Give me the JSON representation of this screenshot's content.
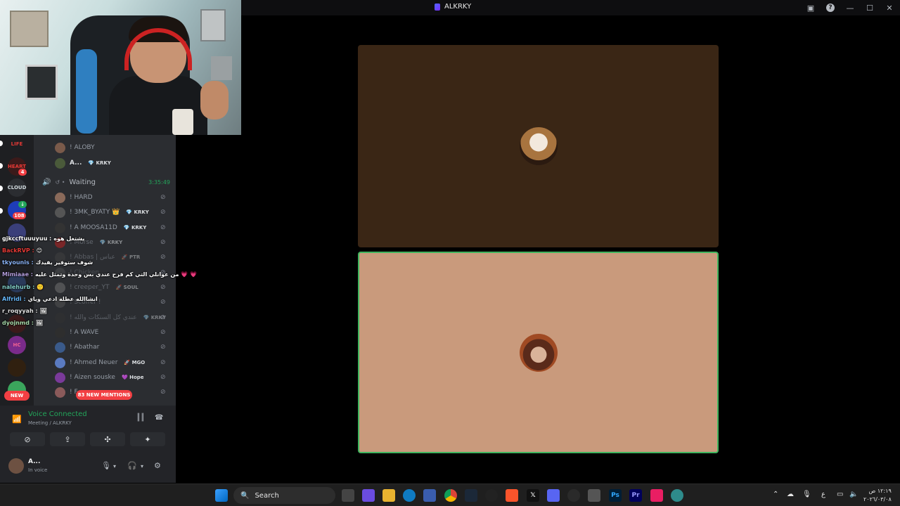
{
  "window": {
    "title": "ALKRKY"
  },
  "servers": [
    {
      "label": "LIFE",
      "color": "#2b2d31"
    },
    {
      "label": "HEART",
      "color": "#3b1a1a",
      "badge": "4"
    },
    {
      "label": "CLOUD",
      "color": "#1e1f22"
    },
    {
      "label": "",
      "color": "#1e3db8",
      "badge": "108"
    },
    {
      "label": "",
      "color": "#3a3f7a"
    },
    {
      "label": "",
      "color": "#222"
    },
    {
      "label": "",
      "color": "#7a2b8a"
    },
    {
      "label": "",
      "color": "#302010"
    },
    {
      "label": "",
      "color": "#3ba55c"
    }
  ],
  "new_button": "NEW",
  "channel_users_top": [
    {
      "name": "! ALOBY",
      "tag": ""
    },
    {
      "name": "A...",
      "tag": "💎 KRKY"
    }
  ],
  "voice_channel": {
    "name": "Waiting",
    "time": "3:35:49"
  },
  "channel_users": [
    {
      "name": "! HARD",
      "tag": ""
    },
    {
      "name": "! 3MK_BYATY 👑",
      "tag": "💎 KRKY"
    },
    {
      "name": "! A MOOSA11D",
      "tag": "💎 KRKY"
    },
    {
      "name": "! Morse",
      "tag": "💎 KRKY"
    },
    {
      "name": "! Abbas | عباس",
      "tag": "🚀 PTR"
    },
    {
      "name": "! Chicken",
      "tag": ""
    },
    {
      "name": "! creeper_YT",
      "tag": "🚀 SOUL"
    },
    {
      "name": "! Scoffer !",
      "tag": ""
    },
    {
      "name": "! عندي كل السنكات والله",
      "tag": "💎 KRKY"
    },
    {
      "name": "! A WAVE",
      "tag": ""
    },
    {
      "name": "! Abathar",
      "tag": ""
    },
    {
      "name": "! Ahmed Neuer",
      "tag": "🚀 MGO"
    },
    {
      "name": "! Aizen souske",
      "tag": "💜 Hope"
    },
    {
      "name": "! F",
      "tag": ""
    }
  ],
  "mentions_label": "83 NEW MENTIONS",
  "chat": [
    {
      "user": "gjkccftuuuyuu :",
      "msg": "يشتغل هوه",
      "color": "#ffffff"
    },
    {
      "user": "BackRVP :",
      "msg": "😊",
      "color": "#e53935"
    },
    {
      "user": "tkyounis :",
      "msg": "شوف ستوفير يفيدك",
      "color": "#8ab4f8"
    },
    {
      "user": "Mimiaae :",
      "msg": "من عوانلي التي كم فرح عندي بس وحدة وتمثل عليه 💗 💗",
      "color": "#b39ddb"
    },
    {
      "user": "nalehurb :",
      "msg": "🙂",
      "color": "#80cbc4"
    },
    {
      "user": "Alfridi :",
      "msg": "انشاالله عطله ادعي وياي",
      "color": "#64b5f6"
    },
    {
      "user": "r_roqyyah :",
      "msg": "🖼",
      "color": "#e0e0e0"
    },
    {
      "user": "dyojnmd :",
      "msg": "🖼",
      "color": "#a5d6a7"
    }
  ],
  "voice_panel": {
    "status": "Voice Connected",
    "channel": "Meeting / ALKRKY"
  },
  "user_panel": {
    "name": "A...",
    "status": "In voice"
  },
  "taskbar": {
    "search_label": "Search",
    "clock_time": "١٢:١٩ ص",
    "clock_date": "٢٠٢٦/٠٣/٠٨",
    "lang": "ع"
  }
}
